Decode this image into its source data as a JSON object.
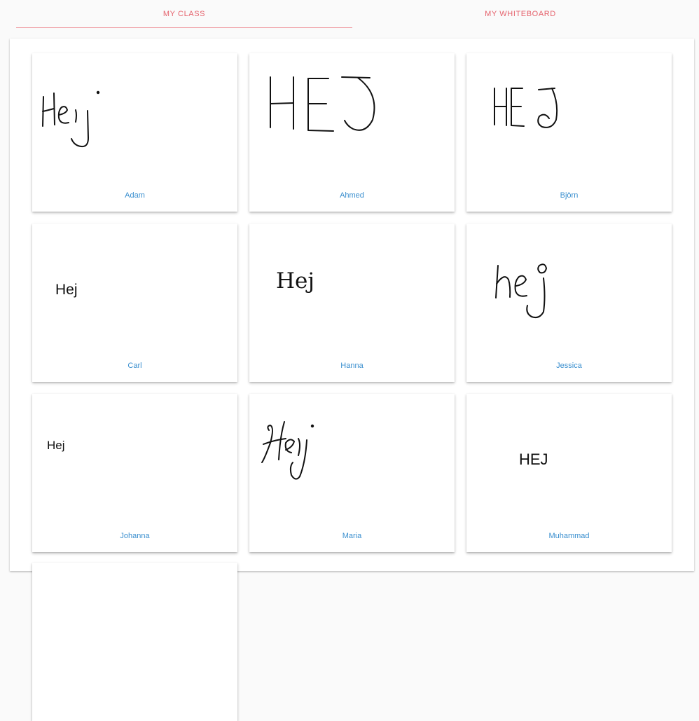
{
  "tabs": {
    "my_class": "MY CLASS",
    "my_whiteboard": "MY WHITEBOARD"
  },
  "students": [
    {
      "name": "Adam"
    },
    {
      "name": "Ahmed"
    },
    {
      "name": "Björn"
    },
    {
      "name": "Carl",
      "text": "Hej"
    },
    {
      "name": "Hanna",
      "text": "Hej"
    },
    {
      "name": "Jessica"
    },
    {
      "name": "Johanna",
      "text": "Hej"
    },
    {
      "name": "Maria"
    },
    {
      "name": "Muhammad",
      "text": "HEJ"
    }
  ],
  "colors": {
    "tab_text": "#e5636d",
    "name_text": "#3a8fcf"
  }
}
